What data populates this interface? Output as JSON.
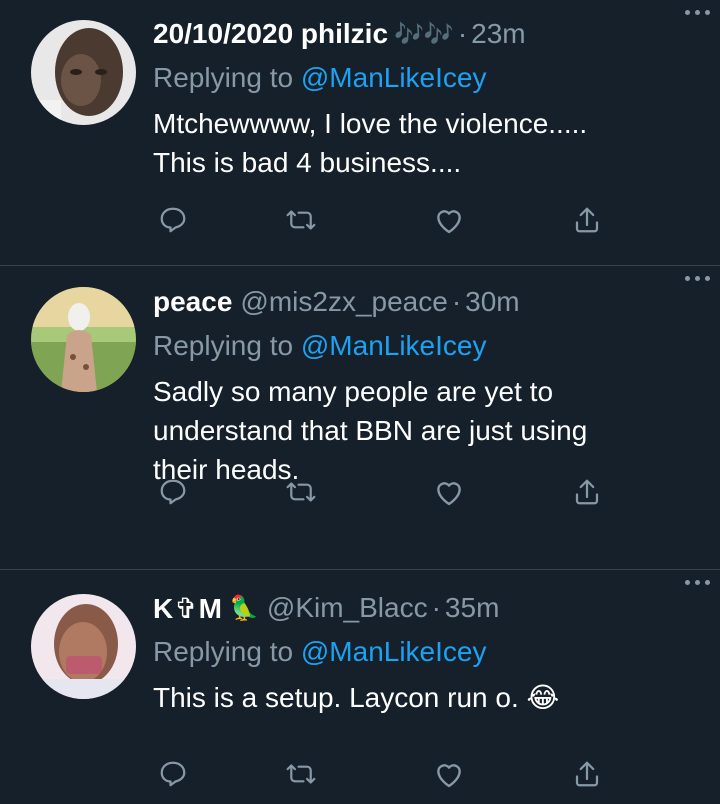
{
  "tweets": [
    {
      "name": "20/10/2020 philzic",
      "name_emoji": "🎶🎶",
      "handle": "",
      "time": "23m",
      "replying_prefix": "Replying to",
      "replying_to": "@ManLikeIcey",
      "text_lines": [
        "Mtchewwww, I love the violence.....",
        "This is bad 4 business...."
      ]
    },
    {
      "name": "peace",
      "name_emoji": "",
      "handle": "@mis2zx_peace",
      "time": "30m",
      "replying_prefix": "Replying to",
      "replying_to": "@ManLikeIcey",
      "text_lines": [
        "Sadly so many people are yet to",
        "understand that BBN are just using",
        "their heads."
      ]
    },
    {
      "name": "K✞M",
      "name_emoji": "🦜",
      "handle": "@Kim_Blacc",
      "time": "35m",
      "replying_prefix": "Replying to",
      "replying_to": "@ManLikeIcey",
      "text_lines": [
        "This is a setup. Laycon run o. 😂"
      ]
    }
  ],
  "separator": "·",
  "colors": {
    "background": "#15202b",
    "muted": "#8899a6",
    "link": "#1da1f2",
    "divider": "#38444d"
  },
  "icons": [
    "reply-icon",
    "retweet-icon",
    "like-icon",
    "share-icon",
    "more-icon"
  ]
}
